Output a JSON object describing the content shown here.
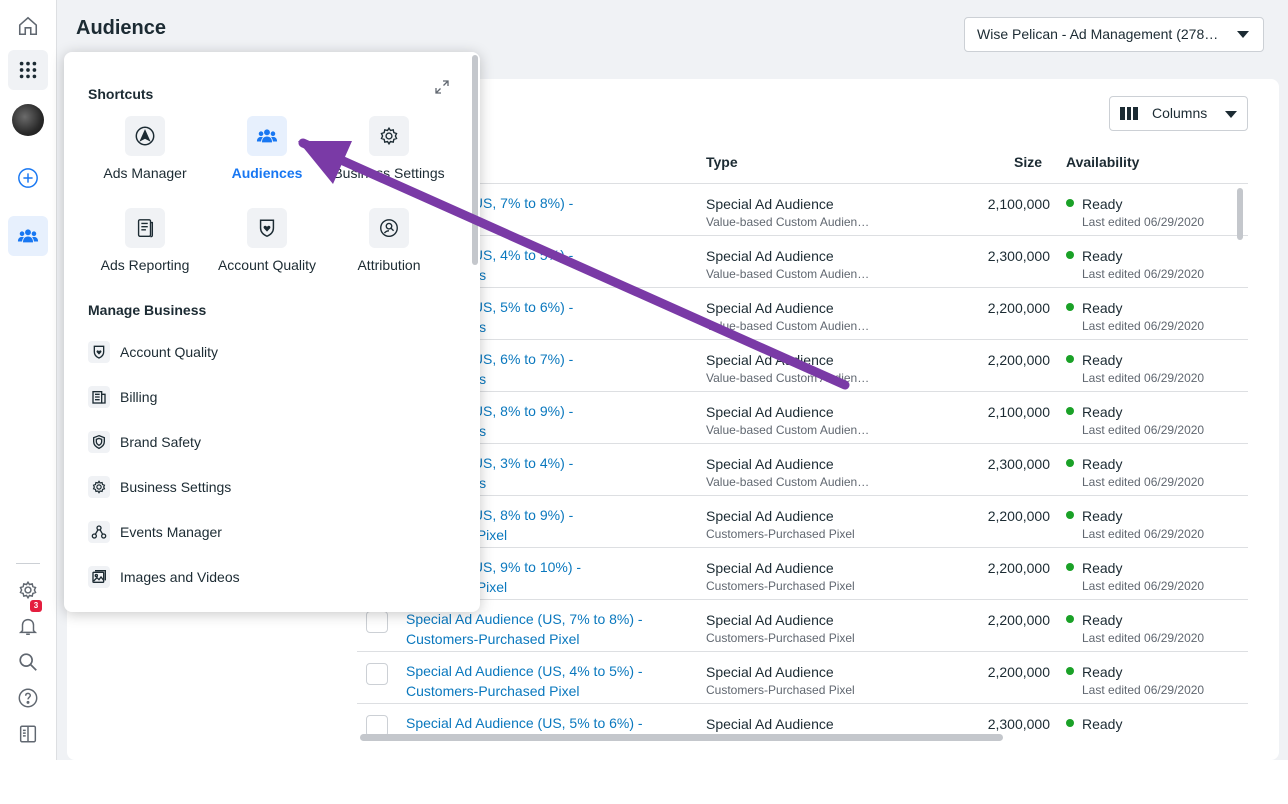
{
  "page": {
    "title": "Audience"
  },
  "account_selector": {
    "value": "Wise Pelican - Ad Management (2785…"
  },
  "columns_button": {
    "label": "Columns"
  },
  "table": {
    "headers": {
      "type": "Type",
      "size": "Size",
      "availability": "Availability"
    },
    "rows": [
      {
        "name1": "Audience (US, 7% to 8%) -",
        "name2": "-Customers",
        "type": "Special Ad Audience",
        "subtype": "Value-based Custom Audien…",
        "size": "2,100,000",
        "status": "Ready",
        "edited": "Last edited 06/29/2020"
      },
      {
        "name1": "Audience (US, 4% to 5%) -",
        "name2": "e-Customers",
        "type": "Special Ad Audience",
        "subtype": "Value-based Custom Audien…",
        "size": "2,300,000",
        "status": "Ready",
        "edited": "Last edited 06/29/2020"
      },
      {
        "name1": "Audience (US, 5% to 6%) -",
        "name2": "e-Customers",
        "type": "Special Ad Audience",
        "subtype": "Value-based Custom Audien…",
        "size": "2,200,000",
        "status": "Ready",
        "edited": "Last edited 06/29/2020"
      },
      {
        "name1": "Audience (US, 6% to 7%) -",
        "name2": "e-Customers",
        "type": "Special Ad Audience",
        "subtype": "Value-based Custom Audien…",
        "size": "2,200,000",
        "status": "Ready",
        "edited": "Last edited 06/29/2020"
      },
      {
        "name1": "Audience (US, 8% to 9%) -",
        "name2": "e-Customers",
        "type": "Special Ad Audience",
        "subtype": "Value-based Custom Audien…",
        "size": "2,100,000",
        "status": "Ready",
        "edited": "Last edited 06/29/2020"
      },
      {
        "name1": "Audience (US, 3% to 4%) -",
        "name2": "e-Customers",
        "type": "Special Ad Audience",
        "subtype": "Value-based Custom Audien…",
        "size": "2,300,000",
        "status": "Ready",
        "edited": "Last edited 06/29/2020"
      },
      {
        "name1": "Audience (US, 8% to 9%) -",
        "name2": "Purchased Pixel",
        "type": "Special Ad Audience",
        "subtype": "Customers-Purchased Pixel",
        "size": "2,200,000",
        "status": "Ready",
        "edited": "Last edited 06/29/2020"
      },
      {
        "name1": "Audience (US, 9% to 10%) -",
        "name2": "Purchased Pixel",
        "type": "Special Ad Audience",
        "subtype": "Customers-Purchased Pixel",
        "size": "2,200,000",
        "status": "Ready",
        "edited": "Last edited 06/29/2020"
      },
      {
        "name1": "Special Ad Audience (US, 7% to 8%) -",
        "name2": "Customers-Purchased Pixel",
        "type": "Special Ad Audience",
        "subtype": "Customers-Purchased Pixel",
        "size": "2,200,000",
        "status": "Ready",
        "edited": "Last edited 06/29/2020"
      },
      {
        "name1": "Special Ad Audience (US, 4% to 5%) -",
        "name2": "Customers-Purchased Pixel",
        "type": "Special Ad Audience",
        "subtype": "Customers-Purchased Pixel",
        "size": "2,200,000",
        "status": "Ready",
        "edited": "Last edited 06/29/2020"
      },
      {
        "name1": "Special Ad Audience (US, 5% to 6%) -",
        "name2": "",
        "type": "Special Ad Audience",
        "subtype": "",
        "size": "2,300,000",
        "status": "Ready",
        "edited": ""
      }
    ]
  },
  "popover": {
    "shortcuts_title": "Shortcuts",
    "shortcuts": [
      {
        "label": "Ads Manager",
        "icon": "ads-manager-icon",
        "selected": false
      },
      {
        "label": "Audiences",
        "icon": "audiences-icon",
        "selected": true
      },
      {
        "label": "Business Settings",
        "icon": "gear-icon",
        "selected": false
      },
      {
        "label": "Ads Reporting",
        "icon": "ads-reporting-icon",
        "selected": false
      },
      {
        "label": "Account Quality",
        "icon": "shield-icon",
        "selected": false
      },
      {
        "label": "Attribution",
        "icon": "attribution-icon",
        "selected": false
      }
    ],
    "manage_title": "Manage Business",
    "manage_items": [
      {
        "label": "Account Quality",
        "icon": "shield-icon"
      },
      {
        "label": "Billing",
        "icon": "billing-icon"
      },
      {
        "label": "Brand Safety",
        "icon": "brand-safety-icon"
      },
      {
        "label": "Business Settings",
        "icon": "gear-icon"
      },
      {
        "label": "Events Manager",
        "icon": "events-manager-icon"
      },
      {
        "label": "Images and Videos",
        "icon": "images-icon"
      }
    ]
  },
  "notifications": {
    "count": "3"
  },
  "colors": {
    "accent": "#1877f2",
    "link": "#0a78be",
    "ready": "#1aa127",
    "annotation": "#7a3aa6"
  }
}
